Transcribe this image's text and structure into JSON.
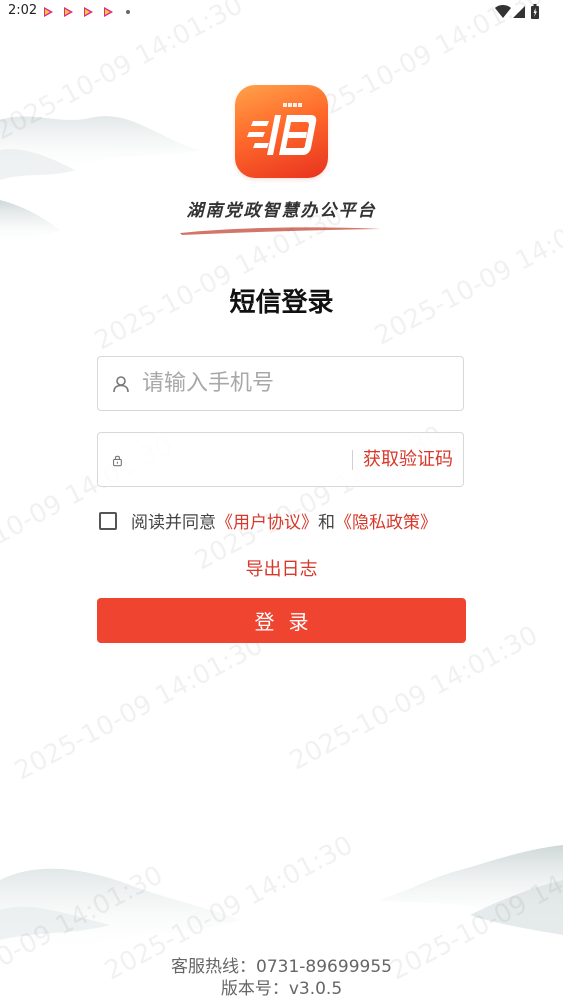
{
  "status_bar": {
    "time": "2:02",
    "app_icons": [
      "play-icon",
      "play-icon",
      "play-icon",
      "play-icon"
    ],
    "indicators": [
      "wifi-icon",
      "signal-icon",
      "battery-icon"
    ]
  },
  "watermark": {
    "text": "2025-10-09 14:01:30"
  },
  "brand": {
    "platform_name": "湖南党政智慧办公平台",
    "logo_color_top": "#ffa24a",
    "logo_color_bottom": "#e8321f"
  },
  "page": {
    "title": "短信登录"
  },
  "phone_field": {
    "placeholder": "请输入手机号",
    "value": "",
    "icon": "user-icon"
  },
  "code_field": {
    "placeholder": "",
    "value": "",
    "icon": "lock-icon",
    "get_code_label": "获取验证码"
  },
  "agreement": {
    "checked": false,
    "prefix": "阅读并同意",
    "user_agreement": "《用户协议》",
    "conjunction": "和",
    "privacy_policy": "《隐私政策》"
  },
  "export_log_label": "导出日志",
  "login_button_label": "登录",
  "footer": {
    "hotline": "客服热线：0731-89699955",
    "version": "版本号：v3.0.5"
  },
  "colors": {
    "accent": "#d7382a",
    "button": "#ee4430"
  }
}
